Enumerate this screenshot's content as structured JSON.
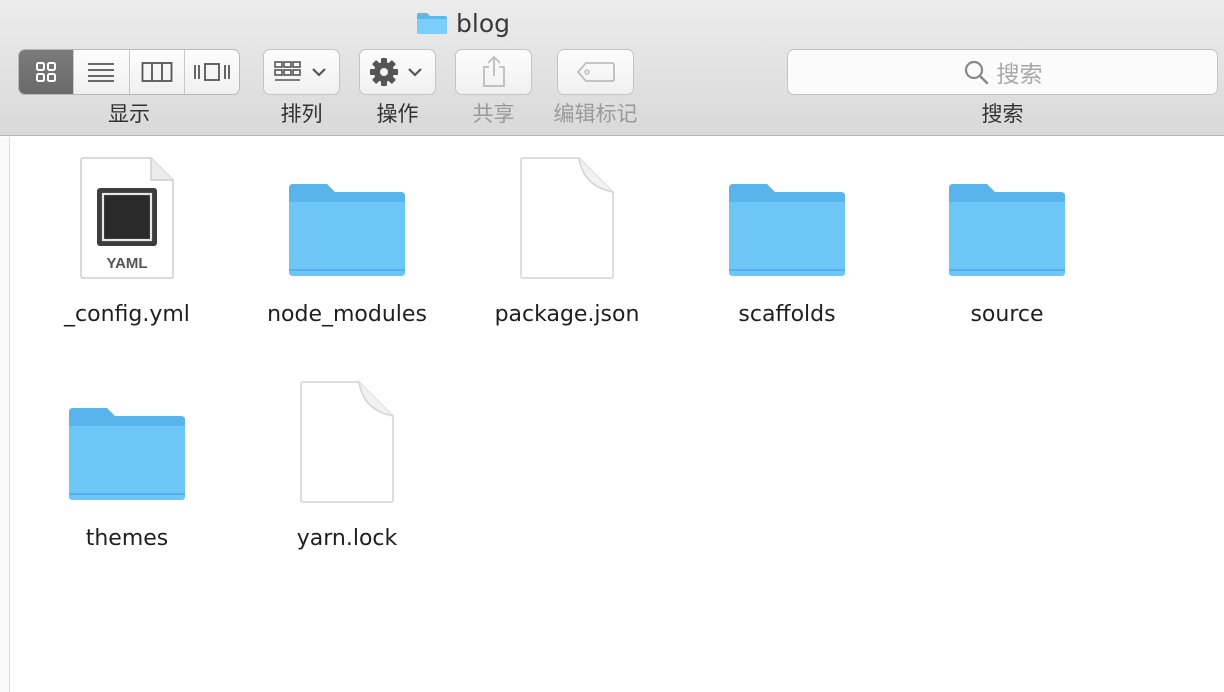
{
  "window": {
    "title": "blog"
  },
  "toolbar": {
    "view_label": "显示",
    "arrange_label": "排列",
    "action_label": "操作",
    "share_label": "共享",
    "tags_label": "编辑标记",
    "search_label": "搜索",
    "search_placeholder": "搜索"
  },
  "files": [
    {
      "name": "_config.yml",
      "kind": "yaml",
      "badge": "YAML"
    },
    {
      "name": "node_modules",
      "kind": "folder"
    },
    {
      "name": "package.json",
      "kind": "document"
    },
    {
      "name": "scaffolds",
      "kind": "folder"
    },
    {
      "name": "source",
      "kind": "folder"
    },
    {
      "name": "themes",
      "kind": "folder"
    },
    {
      "name": "yarn.lock",
      "kind": "document"
    }
  ],
  "colors": {
    "folder": "#6ec6f7",
    "folder_dark": "#58b4ea",
    "toolbar_bg": "#e3e3e3",
    "active_segment": "#707070"
  }
}
